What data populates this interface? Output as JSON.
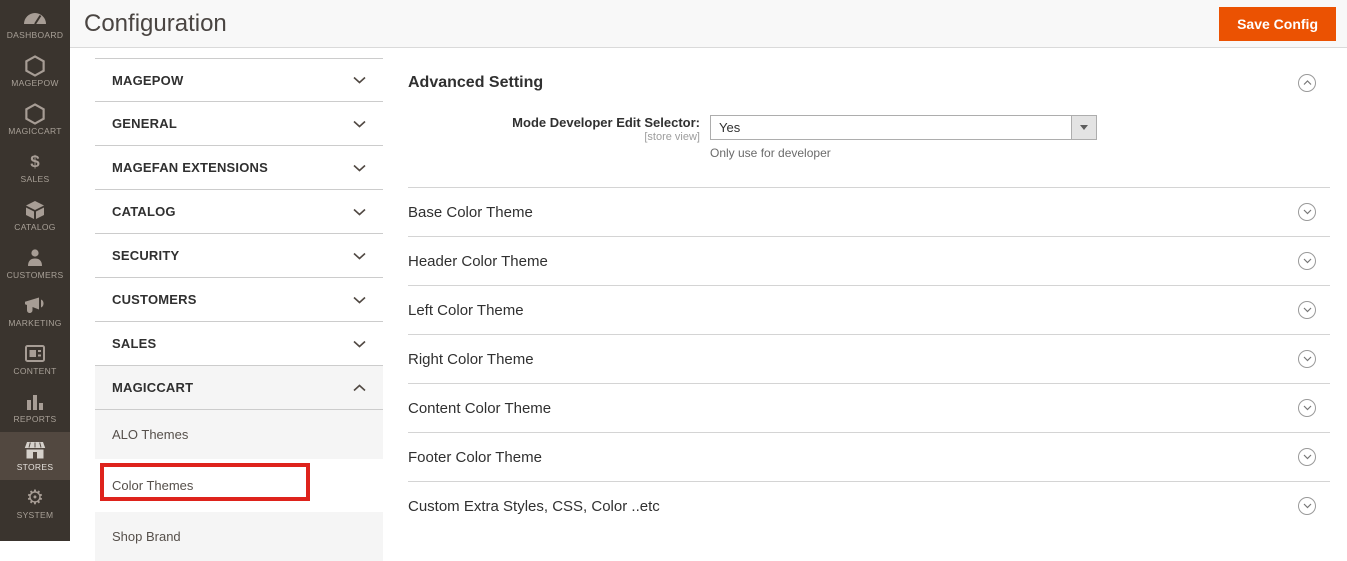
{
  "page": {
    "title": "Configuration"
  },
  "header": {
    "save_button": "Save Config"
  },
  "sidebar": {
    "items": [
      {
        "label": "DASHBOARD",
        "icon": "dashboard-icon",
        "active": false
      },
      {
        "label": "MAGEPOW",
        "icon": "hexagon-icon",
        "active": false
      },
      {
        "label": "MAGICCART",
        "icon": "hexagon-icon",
        "active": false
      },
      {
        "label": "SALES",
        "icon": "dollar-icon",
        "active": false
      },
      {
        "label": "CATALOG",
        "icon": "cube-icon",
        "active": false
      },
      {
        "label": "CUSTOMERS",
        "icon": "person-icon",
        "active": false
      },
      {
        "label": "MARKETING",
        "icon": "megaphone-icon",
        "active": false
      },
      {
        "label": "CONTENT",
        "icon": "layout-icon",
        "active": false
      },
      {
        "label": "REPORTS",
        "icon": "bar-chart-icon",
        "active": false
      },
      {
        "label": "STORES",
        "icon": "storefront-icon",
        "active": true
      },
      {
        "label": "SYSTEM",
        "icon": "gear-icon",
        "active": false
      }
    ]
  },
  "icons": {
    "dollar_glyph": "$",
    "gear_glyph": "⚙"
  },
  "config_nav": {
    "sections": [
      {
        "label": "MAGEPOW",
        "expanded": false
      },
      {
        "label": "GENERAL",
        "expanded": false
      },
      {
        "label": "MAGEFAN EXTENSIONS",
        "expanded": false
      },
      {
        "label": "CATALOG",
        "expanded": false
      },
      {
        "label": "SECURITY",
        "expanded": false
      },
      {
        "label": "CUSTOMERS",
        "expanded": false
      },
      {
        "label": "SALES",
        "expanded": false
      },
      {
        "label": "MAGICCART",
        "expanded": true
      }
    ],
    "children": [
      {
        "label": "ALO Themes",
        "current": false
      },
      {
        "label": "Color Themes",
        "current": true
      },
      {
        "label": "Shop Brand",
        "current": false
      }
    ]
  },
  "main": {
    "advanced": {
      "title": "Advanced Setting",
      "field_label": "Mode Developer Edit Selector:",
      "field_scope": "[store view]",
      "field_value": "Yes",
      "field_note": "Only use for developer"
    },
    "sections": [
      "Base Color Theme",
      "Header Color Theme",
      "Left Color Theme",
      "Right Color Theme",
      "Content Color Theme",
      "Footer Color Theme",
      "Custom Extra Styles, CSS, Color ..etc"
    ]
  },
  "colors": {
    "accent": "#eb5202",
    "sidebar_bg": "#3a342e",
    "sidebar_active_bg": "#524840",
    "annotation_red": "#de231c",
    "header_bg": "#f8f8f8",
    "divider": "#d4d4d4"
  }
}
